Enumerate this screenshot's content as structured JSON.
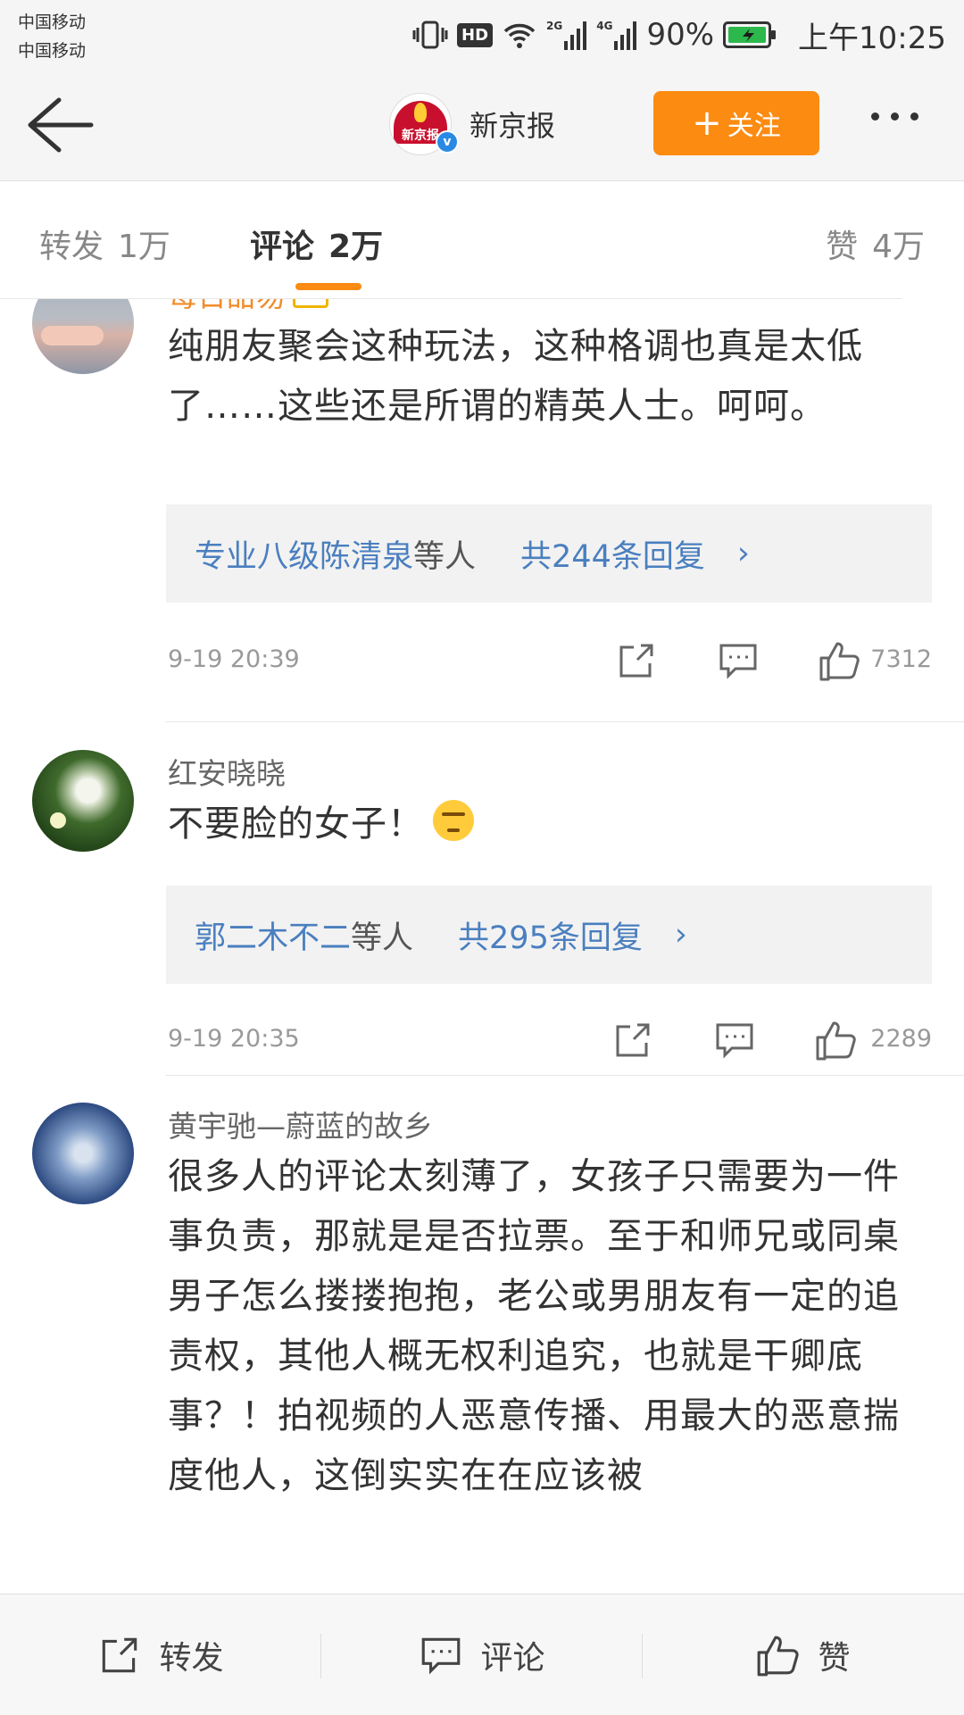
{
  "status_bar": {
    "carrier_1": "中国移动",
    "carrier_2": "中国移动",
    "hd": "HD",
    "net_1": "2G",
    "net_2": "4G",
    "battery": "90%",
    "time": "上午10:25",
    "battery_color": "#2db84d"
  },
  "header": {
    "account_name": "新京报",
    "avatar_text": "新京报",
    "follow_label": "关注",
    "accent_color": "#fc8b12"
  },
  "tabs": {
    "repost_label": "转发",
    "repost_count": "1万",
    "comment_label": "评论",
    "comment_count": "2万",
    "like_label": "赞",
    "like_count": "4万"
  },
  "comments": [
    {
      "username": "每日甜易",
      "text": "纯朋友聚会这种玩法，这种格调也真是太低了……这些还是所谓的精英人士。呵呵。",
      "reply_users": "专业八级陈清泉",
      "reply_etc": "等人",
      "reply_total": "共244条回复",
      "time": "9-19  20:39",
      "likes": "7312"
    },
    {
      "username": "红安晓晓",
      "text": "不要脸的女子！",
      "reply_users": "郭二木不二",
      "reply_etc": "等人",
      "reply_total": "共295条回复",
      "time": "9-19  20:35",
      "likes": "2289"
    },
    {
      "username": "黄宇驰—蔚蓝的故乡",
      "text": "很多人的评论太刻薄了，女孩子只需要为一件事负责，那就是是否拉票。至于和师兄或同桌男子怎么搂搂抱抱，老公或男朋友有一定的追责权，其他人概无权利追究，也就是干卿底事？！拍视频的人恶意传播、用最大的恶意揣度他人，这倒实实在在应该被"
    }
  ],
  "bottom_bar": {
    "repost_label": "转发",
    "comment_label": "评论",
    "like_label": "赞"
  }
}
